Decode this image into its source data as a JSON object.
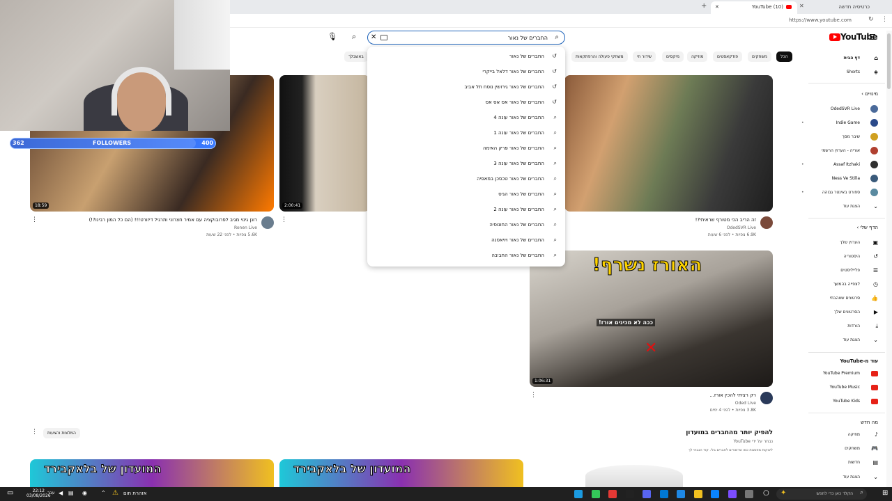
{
  "browser": {
    "tabs": [
      {
        "label": "כרטיסיה חדשה"
      },
      {
        "label": "(10) YouTube"
      }
    ],
    "url": "https://www.youtube.com"
  },
  "stream_overlay": {
    "followers_current": "362",
    "followers_label": "FOLLOWERS",
    "followers_goal": "400",
    "progress": 0.905
  },
  "header": {
    "logo_text": "YouTube",
    "search_value": "החברים של נאור"
  },
  "chips": [
    "הכל",
    "משחקים",
    "פודקאסטים",
    "מוזיקה",
    "מיקסים",
    "שידור חי",
    "משחקי פעולה והרפתקאות",
    "לא נצפו",
    "באשבלך"
  ],
  "suggestions": [
    {
      "text": "החברים של נאור",
      "icon": "history"
    },
    {
      "text": "החברים של נאור דלאל בייקרי",
      "icon": "history"
    },
    {
      "text": "החברים של נאור גירושין נוסח תל אביב",
      "icon": "history"
    },
    {
      "text": "החברים של נאור אס אס אס",
      "icon": "history"
    },
    {
      "text": "החברים של נאור עונה 4",
      "icon": "search"
    },
    {
      "text": "החברים של נאור עונה 1",
      "icon": "search"
    },
    {
      "text": "החברים של נאור פרק האימה",
      "icon": "search"
    },
    {
      "text": "החברים של נאור עונה 3",
      "icon": "search"
    },
    {
      "text": "החברים של נאור טכסכן במאפיה",
      "icon": "search"
    },
    {
      "text": "החברים של נאור הגיס",
      "icon": "search"
    },
    {
      "text": "החברים של נאור עונה 2",
      "icon": "search"
    },
    {
      "text": "החברים של נאור החונוסיה",
      "icon": "search"
    },
    {
      "text": "החברים של נאור ויויאסנה",
      "icon": "search"
    },
    {
      "text": "החברים של נאור החביבה",
      "icon": "search"
    }
  ],
  "videos": [
    {
      "title": "רונן גינוי מגיב לפרובוקציה עם אמיר חצרוני ותרגיל דיזורט!!! (הם כל המון רבינו?!)",
      "channel": "Ronen Live",
      "meta": "5.6K צפיות • לפני 22 שעות",
      "duration": "18:59"
    },
    {
      "title": "",
      "channel": "",
      "meta": "",
      "duration": "2:00:41"
    },
    {
      "title": "זה הריב הכי מטורף שראיתי?!",
      "channel": "OdedSVR Live",
      "meta": "6.9K צפיות • לפני 6 שעות",
      "duration": ""
    },
    {
      "title": "רק רציתי להכין אורז...",
      "channel": "Oded Live",
      "meta": "3.8K צפיות • לפני 4 ימים",
      "duration": "1:06:31",
      "overlay_title": "האורז נשרף!",
      "overlay_caption": "ככה לא מכינים אורז!"
    }
  ],
  "shelf": {
    "title": "להפיק יותר מהחברים במועדון",
    "subtitle": "נבחר על ידי YouTube",
    "description": "לינוקות מפסגות כמו שרשורים לחברים בלי. קוד הנבחי לך",
    "button": "המלצות והצעות",
    "thumb_text": "המועדון של בלאקבירד"
  },
  "sidebar": {
    "home": "דף הבית",
    "shorts": "Shorts",
    "subs_header": "מינויים",
    "channels": [
      {
        "name": "OdedSVR Live",
        "dot": false
      },
      {
        "name": "Indie Game",
        "dot": true
      },
      {
        "name": "שיבר מסך",
        "dot": false
      },
      {
        "name": "אוריה - הערוץ הרשמי",
        "dot": false
      },
      {
        "name": "Assaf Itzhaki",
        "dot": true
      },
      {
        "name": "Ness Ve Stilla",
        "dot": false
      },
      {
        "name": "ספורט באינטר גבוהה",
        "dot": true
      }
    ],
    "show_more": "הצגת עוד",
    "you_header": "הדף שלי",
    "you_items": [
      "הערוץ שלך",
      "היסטוריה",
      "פלייליסטים",
      "לצפייה בהמשך",
      "סרטונים שאהבתי",
      "הסרטונים שלך",
      "הורדות"
    ],
    "more_yt_header": "עוד מ-YouTube",
    "more_yt": [
      "YouTube Premium",
      "YouTube Music",
      "YouTube Kids"
    ],
    "explore_header": "מה חדש",
    "explore": [
      "מוזיקה",
      "משחקים",
      "חדשות"
    ]
  },
  "taskbar": {
    "time": "22:12",
    "date": "03/08/2026",
    "lang": "עבר",
    "alert": "אזהרת חום",
    "search_placeholder": "הקלד כאן כדי לחפש"
  },
  "colors": {
    "accent": "#ff0000",
    "search_border": "#1c62b9"
  }
}
